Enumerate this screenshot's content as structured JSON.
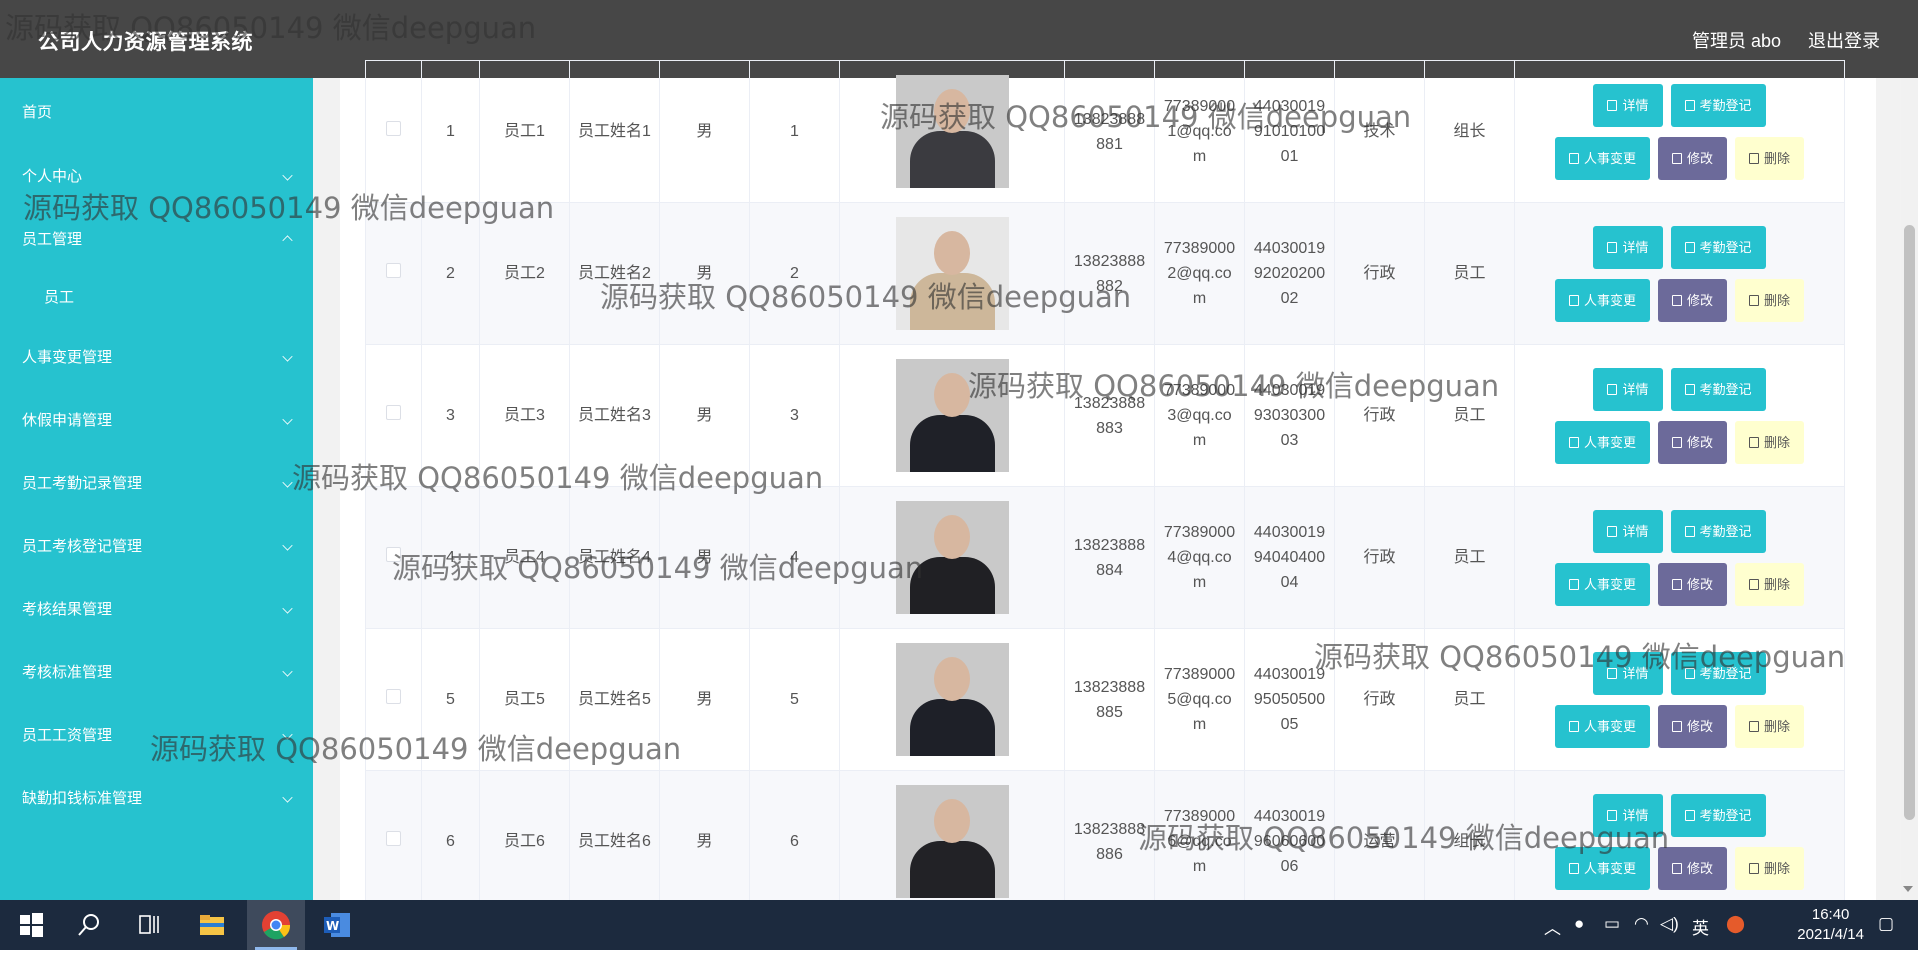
{
  "header": {
    "app_title": "公司人力资源管理系统",
    "user_label": "管理员 abo",
    "logout_label": "退出登录"
  },
  "sidebar": {
    "items": [
      {
        "label": "首页"
      },
      {
        "label": "个人中心"
      },
      {
        "label": "员工管理"
      },
      {
        "label": "人事变更管理"
      },
      {
        "label": "休假申请管理"
      },
      {
        "label": "员工考勤记录管理"
      },
      {
        "label": "员工考核登记管理"
      },
      {
        "label": "考核结果管理"
      },
      {
        "label": "考核标准管理"
      },
      {
        "label": "员工工资管理"
      },
      {
        "label": "缺勤扣钱标准管理"
      }
    ],
    "sub_items": [
      {
        "label": "员工"
      }
    ]
  },
  "table": {
    "rows": [
      {
        "index": "1",
        "account": "员工1",
        "name": "员工姓名1",
        "gender": "男",
        "age": "1",
        "phone": "13823888881",
        "email": "773890001@qq.com",
        "id_card": "440300199101010001",
        "dept": "技术",
        "position": "组长",
        "photo_color": "#3b3b40"
      },
      {
        "index": "2",
        "account": "员工2",
        "name": "员工姓名2",
        "gender": "男",
        "age": "2",
        "phone": "13823888882",
        "email": "773890002@qq.com",
        "id_card": "440300199202020002",
        "dept": "行政",
        "position": "员工",
        "photo_color": "#cdb79a"
      },
      {
        "index": "3",
        "account": "员工3",
        "name": "员工姓名3",
        "gender": "男",
        "age": "3",
        "phone": "13823888883",
        "email": "773890003@qq.com",
        "id_card": "440300199303030003",
        "dept": "行政",
        "position": "员工",
        "photo_color": "#1f2128"
      },
      {
        "index": "4",
        "account": "员工4",
        "name": "员工姓名4",
        "gender": "男",
        "age": "4",
        "phone": "13823888884",
        "email": "773890004@qq.com",
        "id_card": "440300199404040004",
        "dept": "行政",
        "position": "员工",
        "photo_color": "#202024"
      },
      {
        "index": "5",
        "account": "员工5",
        "name": "员工姓名5",
        "gender": "男",
        "age": "5",
        "phone": "13823888885",
        "email": "773890005@qq.com",
        "id_card": "440300199505050005",
        "dept": "行政",
        "position": "员工",
        "photo_color": "#1e2028"
      },
      {
        "index": "6",
        "account": "员工6",
        "name": "员工姓名6",
        "gender": "男",
        "age": "6",
        "phone": "13823888886",
        "email": "773890006@qq.com",
        "id_card": "440300199606060006",
        "dept": "运营",
        "position": "组长",
        "photo_color": "#222226"
      }
    ],
    "actions": {
      "detail": "详情",
      "attendance": "考勤登记",
      "change": "人事变更",
      "edit": "修改",
      "delete": "删除"
    }
  },
  "watermark": "源码获取 QQ86050149 微信deepguan",
  "taskbar": {
    "time": "16:40",
    "date": "2021/4/14",
    "ime": "英"
  }
}
